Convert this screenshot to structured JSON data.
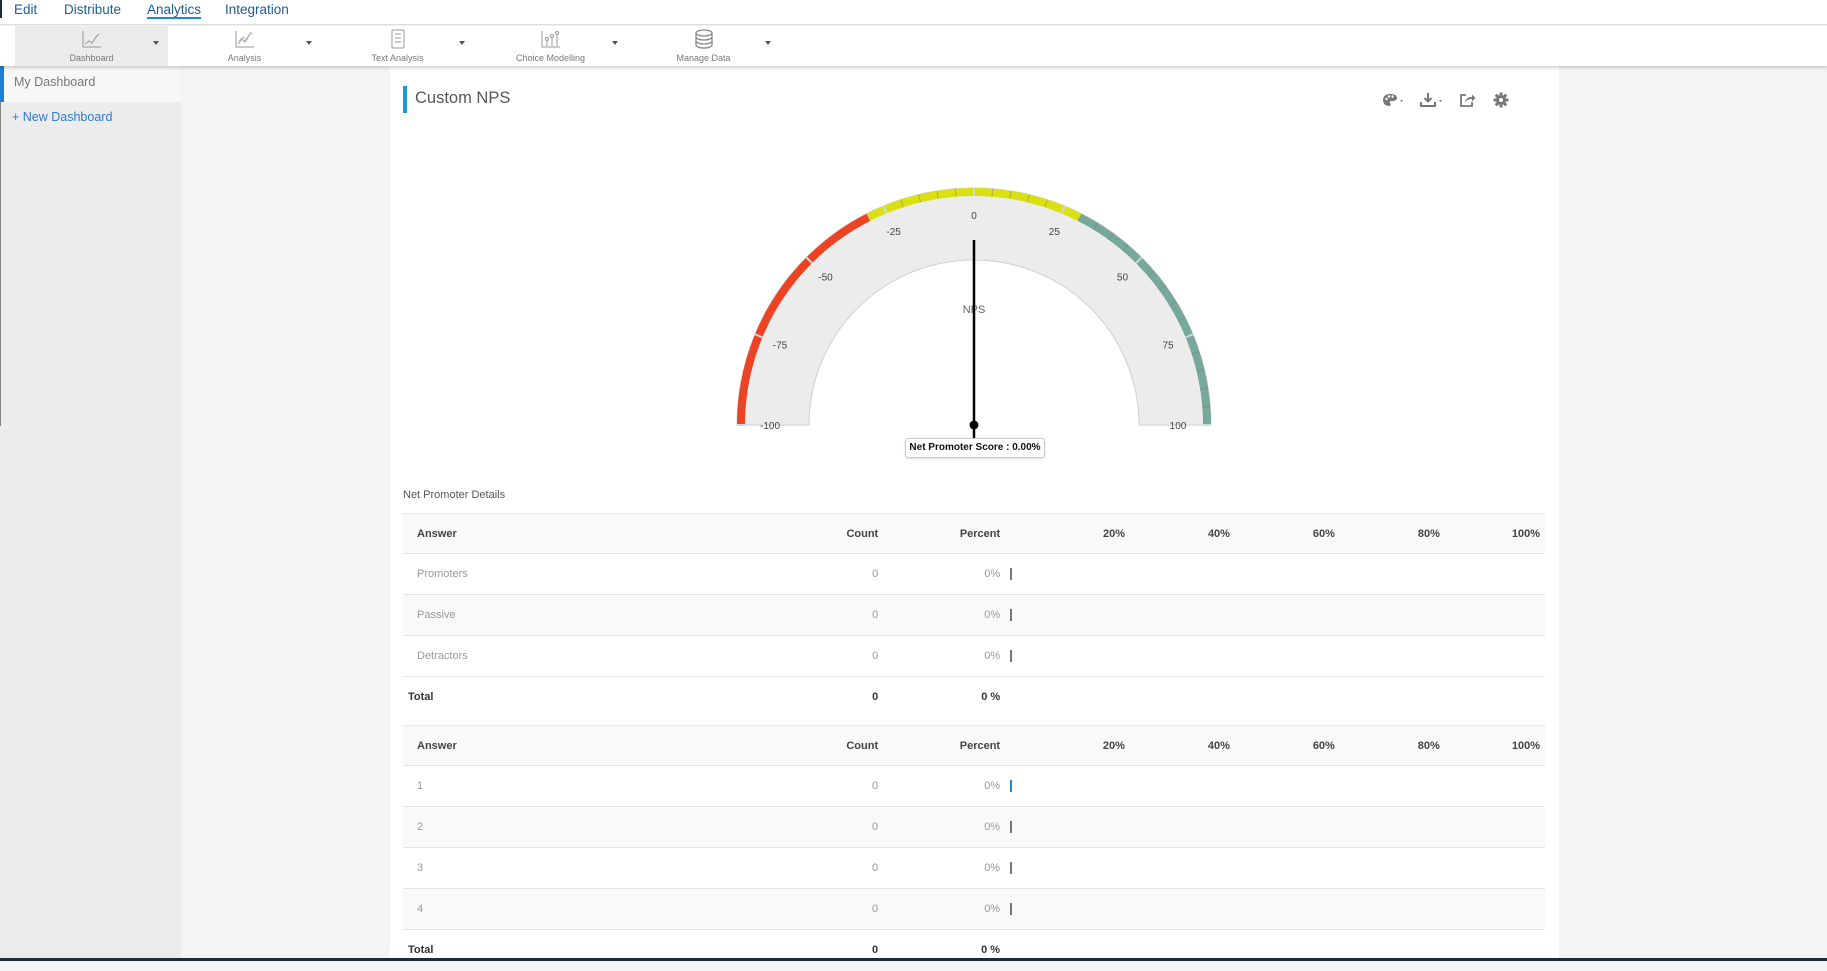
{
  "topnav": {
    "items": [
      {
        "label": "Edit",
        "active": false
      },
      {
        "label": "Distribute",
        "active": false
      },
      {
        "label": "Analytics",
        "active": true
      },
      {
        "label": "Integration",
        "active": false
      }
    ]
  },
  "toolbar": {
    "items": [
      {
        "label": "Dashboard",
        "icon": "line-chart-icon",
        "active": true
      },
      {
        "label": "Analysis",
        "icon": "scatter-chart-icon",
        "active": false
      },
      {
        "label": "Text Analysis",
        "icon": "text-document-icon",
        "active": false
      },
      {
        "label": "Choice Modelling",
        "icon": "choice-chart-icon",
        "active": false
      },
      {
        "label": "Manage Data",
        "icon": "database-icon",
        "active": false
      }
    ]
  },
  "sidebar": {
    "active_item": "My Dashboard",
    "new_item": "+ New Dashboard"
  },
  "card": {
    "title": "Custom NPS",
    "tools": [
      "palette-icon",
      "download-icon",
      "share-icon",
      "gear-icon"
    ],
    "accent_color": "#1a9ad6"
  },
  "chart_data": {
    "type": "gauge",
    "title": "NPS",
    "value": 0,
    "range": [
      -100,
      100
    ],
    "tick_labels": [
      "-100",
      "-75",
      "-50",
      "-25",
      "0",
      "25",
      "50",
      "75",
      "100"
    ],
    "bands": [
      {
        "from": -100,
        "to": -30,
        "color": "#ee4223"
      },
      {
        "from": -30,
        "to": 30,
        "color": "#dbe110"
      },
      {
        "from": 30,
        "to": 100,
        "color": "#76a89c"
      }
    ],
    "tooltip": "Net Promoter Score : 0.00%"
  },
  "details": {
    "label": "Net Promoter Details",
    "headers": {
      "answer": "Answer",
      "count": "Count",
      "percent": "Percent",
      "scale": [
        "20%",
        "40%",
        "60%",
        "80%",
        "100%"
      ]
    },
    "table1": {
      "rows": [
        {
          "answer": "Promoters",
          "count": "0",
          "percent": "0%",
          "fraction": 0
        },
        {
          "answer": "Passive",
          "count": "0",
          "percent": "0%",
          "fraction": 0
        },
        {
          "answer": "Detractors",
          "count": "0",
          "percent": "0%",
          "fraction": 0
        }
      ],
      "total": {
        "label": "Total",
        "count": "0",
        "percent": "0 %"
      }
    },
    "table2": {
      "rows": [
        {
          "answer": "1",
          "count": "0",
          "percent": "0%",
          "fraction": 0
        },
        {
          "answer": "2",
          "count": "0",
          "percent": "0%",
          "fraction": 0
        },
        {
          "answer": "3",
          "count": "0",
          "percent": "0%",
          "fraction": 0
        },
        {
          "answer": "4",
          "count": "0",
          "percent": "0%",
          "fraction": 0
        }
      ],
      "total": {
        "label": "Total",
        "count": "0",
        "percent": "0 %"
      }
    }
  }
}
